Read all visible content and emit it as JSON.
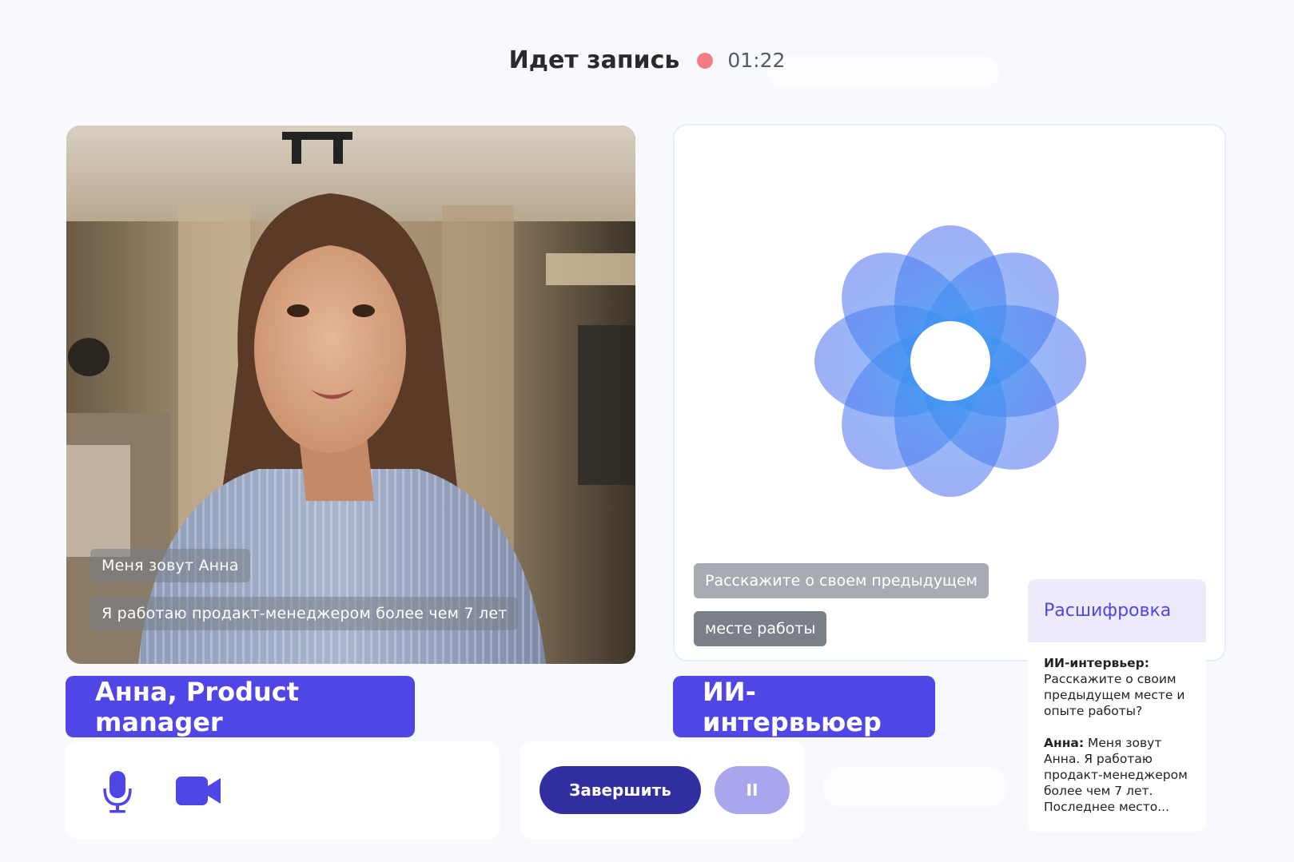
{
  "header": {
    "title": "Идет запись",
    "timer": "01:22"
  },
  "candidate": {
    "captions": [
      "Меня зовут Анна",
      "Я работаю продакт-менеджером более чем 7 лет"
    ],
    "name_tag": "Анна, Product manager"
  },
  "ai": {
    "captions": [
      "Расскажите о своем предыдущем",
      "месте работы"
    ],
    "name_tag": "ИИ-интервьюер"
  },
  "controls": {
    "mic_icon": "microphone-icon",
    "camera_icon": "video-camera-icon",
    "end_label": "Завершить",
    "pause_label": "II"
  },
  "transcript": {
    "title": "Расшифровка",
    "entries": [
      {
        "speaker": "ИИ-интервьер:",
        "text": "Расскажите о своим предыдущем месте и опыте работы?"
      },
      {
        "speaker": "Анна:",
        "text": "Меня зовут Анна. Я работаю продакт-менеджером более чем 7 лет. Последнее место..."
      }
    ]
  },
  "colors": {
    "accent": "#4f46e5",
    "end_button": "#312e9f",
    "pause_button": "#a9a6ee",
    "recording_dot": "#f47b86"
  }
}
